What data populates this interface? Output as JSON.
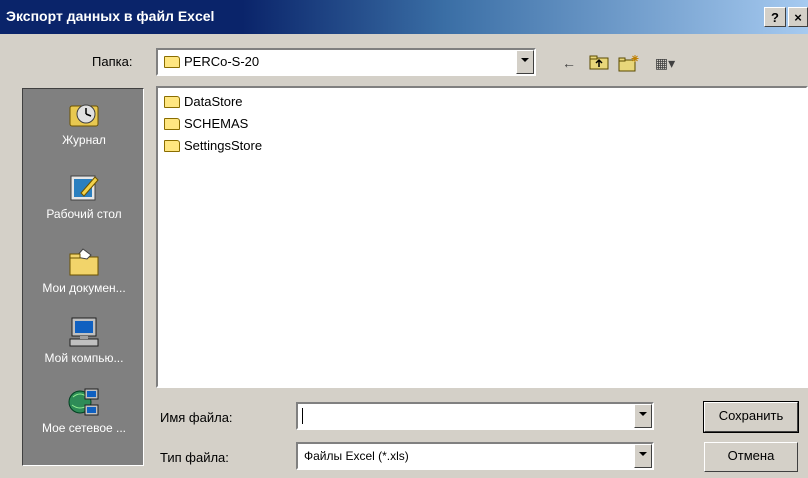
{
  "window": {
    "title": "Экспорт данных в файл Excel",
    "help_label": "?",
    "close_label": "×"
  },
  "lookin": {
    "label": "Папка:",
    "value": "PERCo-S-20"
  },
  "toolbar": {
    "back_label": "←",
    "viewmenu_label": "▦▾"
  },
  "places": [
    {
      "label": "Журнал",
      "icon": "history-icon"
    },
    {
      "label": "Рабочий стол",
      "icon": "desktop-icon"
    },
    {
      "label": "Мои докумен...",
      "icon": "my-documents-icon"
    },
    {
      "label": "Мой компью...",
      "icon": "my-computer-icon"
    },
    {
      "label": "Мое сетевое ...",
      "icon": "network-places-icon"
    }
  ],
  "files": [
    "DataStore",
    "SCHEMAS",
    "SettingsStore"
  ],
  "filename": {
    "label": "Имя файла:",
    "value": ""
  },
  "filetype": {
    "label": "Тип файла:",
    "value": "Файлы Excel (*.xls)"
  },
  "buttons": {
    "save": "Сохранить",
    "cancel": "Отмена"
  }
}
